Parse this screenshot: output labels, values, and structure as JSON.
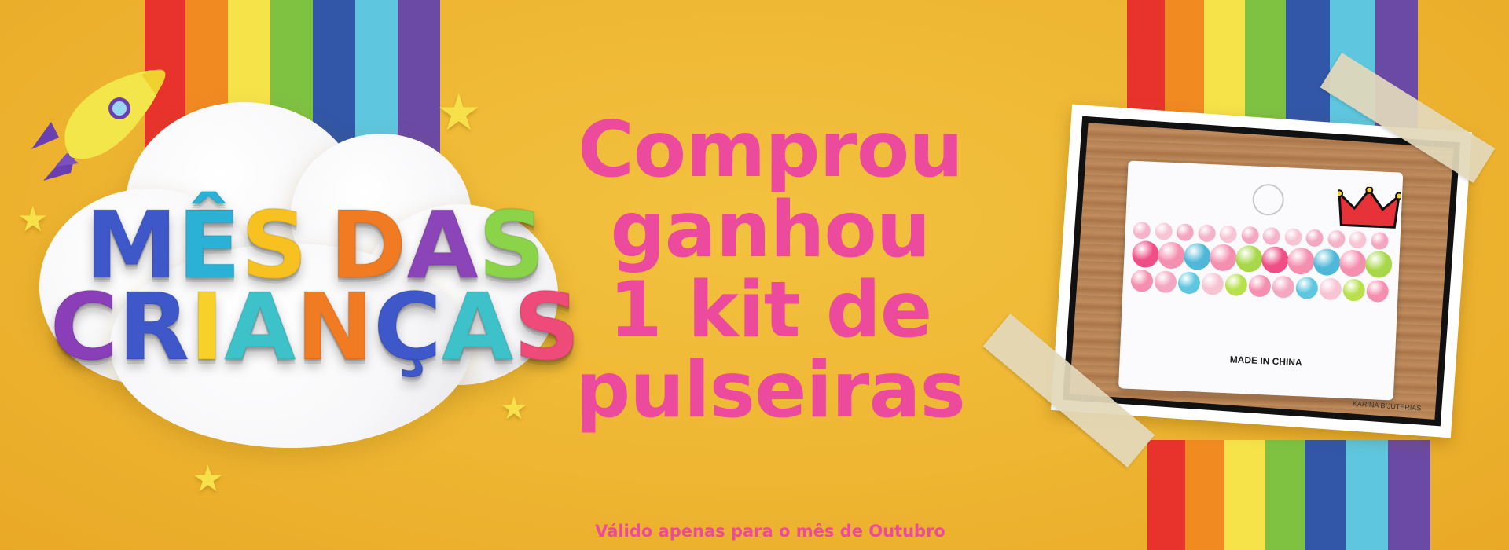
{
  "banner": {
    "title_line1": [
      "M",
      "Ê",
      "S",
      " ",
      "D",
      "A",
      "S"
    ],
    "title_line2": [
      "C",
      "R",
      "I",
      "A",
      "N",
      "Ç",
      "A",
      "S"
    ],
    "title_line1_colors": [
      "#3e57c9",
      "#2bb0d6",
      "#f7c21f",
      "#ffffff",
      "#f07b22",
      "#8c45b8",
      "#8bd44a"
    ],
    "title_line2_colors": [
      "#8a3fb8",
      "#3e57c9",
      "#f7d12a",
      "#3ec2c9",
      "#f07b22",
      "#3e57c9",
      "#3ec2c9",
      "#ee4b7a"
    ],
    "headline_lines": [
      "Comprou",
      "ganhou",
      "1 kit de",
      "pulseiras"
    ],
    "validity_note": "Válido apenas para o mês de Outubro",
    "photo_caption": "MADE IN CHINA",
    "photo_signature": "KARINA BIJUTERIAS",
    "colors": {
      "background": "#eeb632",
      "headline": "#ec4a9d",
      "rainbow": [
        "#e8332c",
        "#f28a22",
        "#f6e34a",
        "#7fc242",
        "#3257a8",
        "#5ec7df",
        "#6b4aa6"
      ]
    },
    "icons": [
      "rocket-icon",
      "star-icon",
      "cloud-icon",
      "crown-icon"
    ]
  }
}
